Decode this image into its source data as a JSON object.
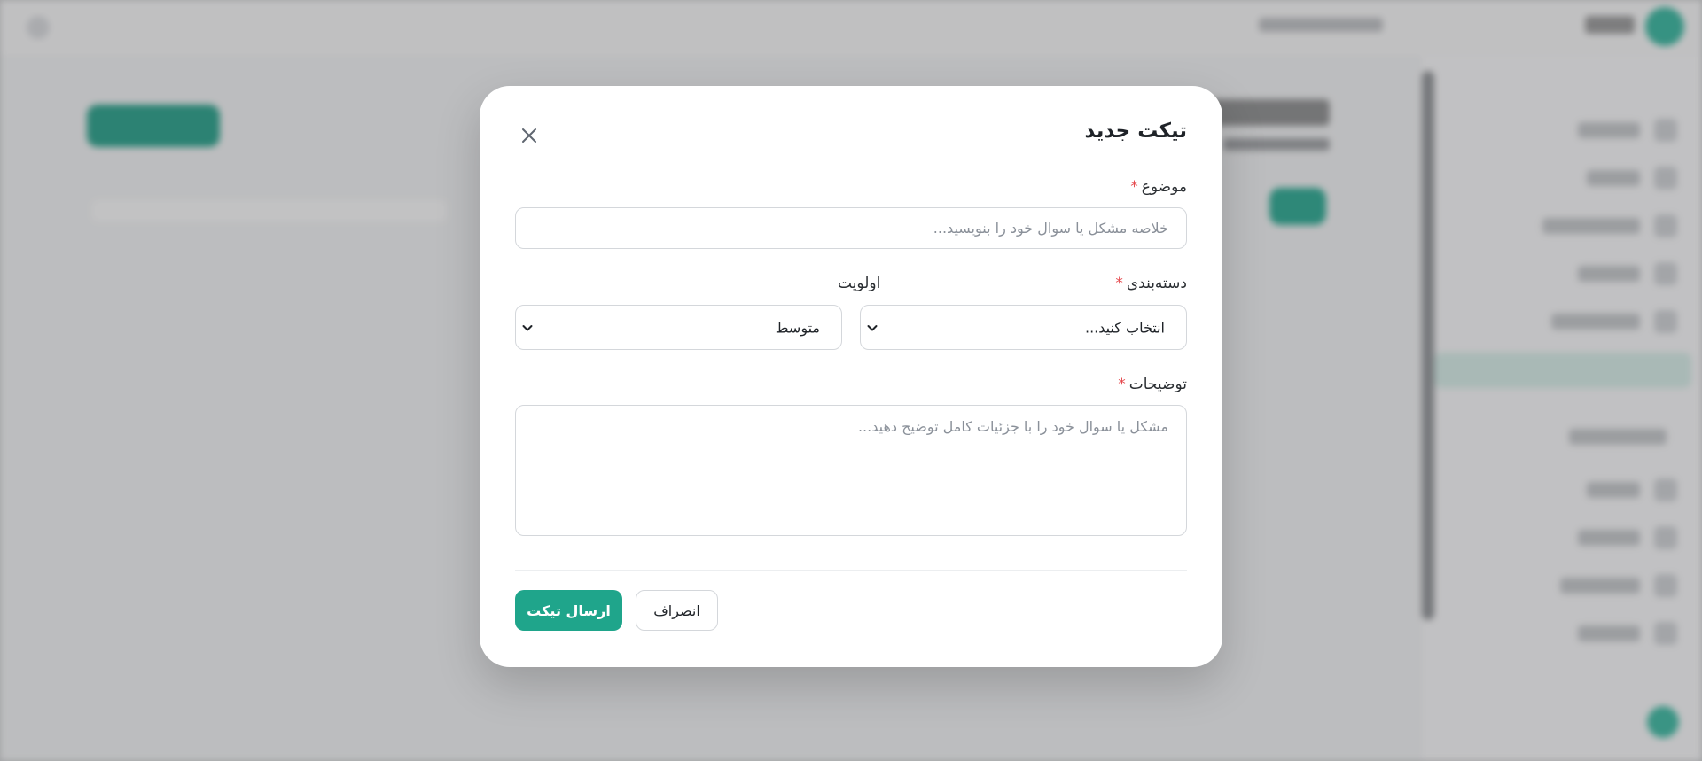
{
  "modal": {
    "title": "تیکت جدید",
    "subject": {
      "label": "موضوع",
      "required_mark": "*",
      "placeholder": "خلاصه مشکل یا سوال خود را بنویسید...",
      "value": ""
    },
    "category": {
      "label": "دسته‌بندی",
      "required_mark": "*",
      "selected": "انتخاب کنید..."
    },
    "priority": {
      "label": "اولویت",
      "selected": "متوسط"
    },
    "description": {
      "label": "توضیحات",
      "required_mark": "*",
      "placeholder": "مشکل یا سوال خود را با جزئیات کامل توضیح دهید...",
      "value": ""
    },
    "buttons": {
      "submit": "ارسال تیکت",
      "cancel": "انصراف"
    }
  },
  "colors": {
    "accent": "#1fa58b",
    "required": "#e5484d",
    "overlay": "rgba(70,72,76,0.32)"
  },
  "icons": {
    "close": "close-icon",
    "chevron": "chevron-down-icon"
  }
}
